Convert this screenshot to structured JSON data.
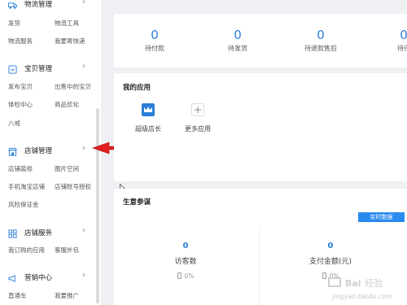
{
  "sidebar": {
    "sections": [
      {
        "title": "物流管理",
        "icon": "truck-icon",
        "links": [
          "发货",
          "物流工具",
          "物流服务",
          "我要寄快递"
        ]
      },
      {
        "title": "宝贝管理",
        "icon": "package-icon",
        "links": [
          "发布宝贝",
          "出售中的宝贝",
          "体检中心",
          "商品优化",
          "八戒"
        ]
      },
      {
        "title": "店铺管理",
        "icon": "store-icon",
        "links": [
          "店铺装修",
          "图片空间",
          "手机淘宝店铺",
          "店铺账号授权",
          "风险保证金"
        ]
      },
      {
        "title": "店铺服务",
        "icon": "grid-icon",
        "links": [
          "我订购的应用",
          "客服外包"
        ]
      },
      {
        "title": "营销中心",
        "icon": "megaphone-icon",
        "links": [
          "直通车",
          "我要推广"
        ]
      }
    ],
    "chevron": "›"
  },
  "stats": [
    {
      "value": "0",
      "label": "待付款"
    },
    {
      "value": "0",
      "label": "待发货"
    },
    {
      "value": "0",
      "label": "待退款售后"
    },
    {
      "value": "0",
      "label": "待评"
    }
  ],
  "apps": {
    "title": "我的应用",
    "items": [
      {
        "label": "超级店长",
        "icon": "crown-icon"
      },
      {
        "label": "更多应用",
        "icon": "plus-icon"
      }
    ]
  },
  "business": {
    "title": "生意参谋",
    "realtime_button": "实时数据",
    "metrics": [
      {
        "value": "0",
        "label": "访客数",
        "percent": "0%"
      },
      {
        "value": "0",
        "label": "支付金额(元)",
        "percent": "0%"
      }
    ]
  },
  "colors": {
    "accent": "#2a7fd6",
    "arrow": "#e02020",
    "button": "#2a8af0"
  },
  "watermark": {
    "text": "jingyan.baidu.com"
  }
}
